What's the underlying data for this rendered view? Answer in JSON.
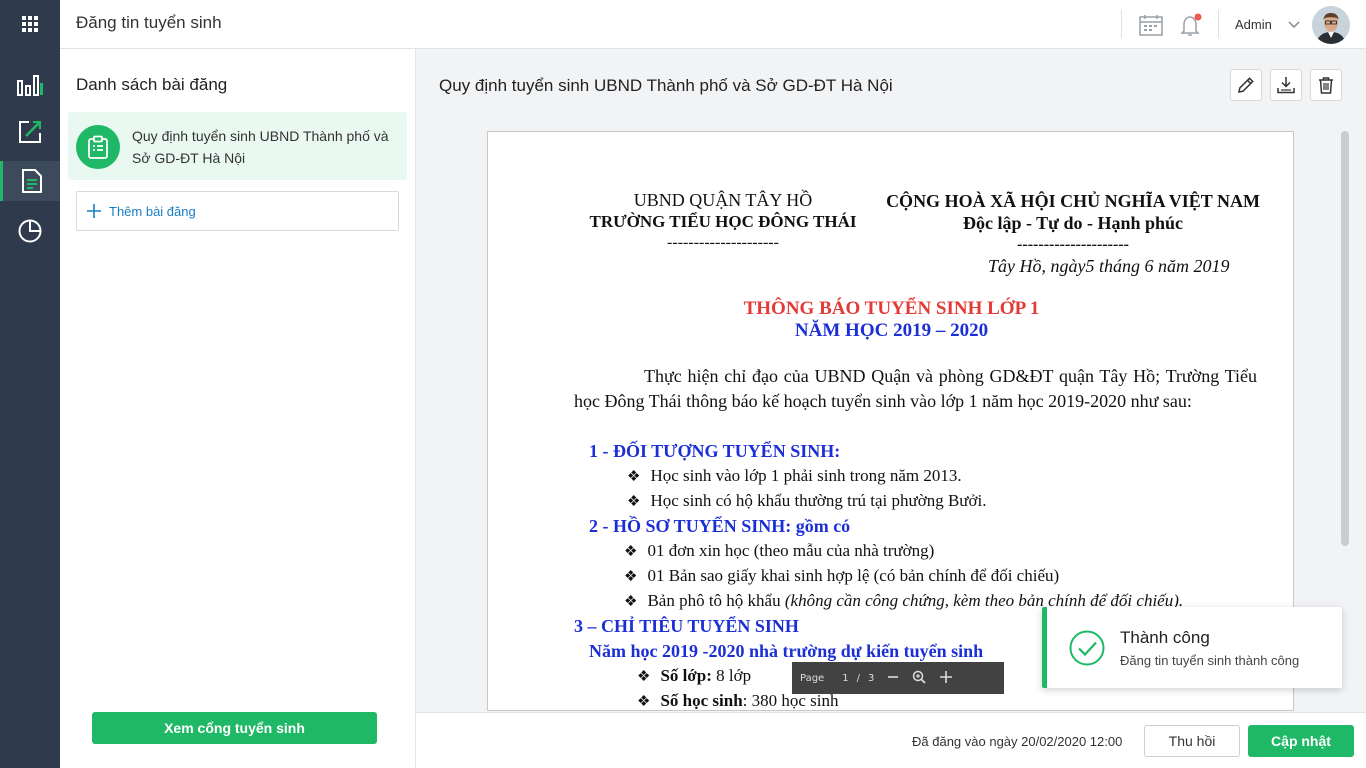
{
  "app": {
    "title": "Đăng tin tuyển sinh"
  },
  "topbar": {
    "user_name": "Admin",
    "icons": [
      "calendar-icon",
      "bell-icon",
      "chevron-down-icon"
    ],
    "notification_dot_color": "#f0574f"
  },
  "sidebar": {
    "items": [
      {
        "name": "dashboard",
        "icon": "bar-chart-icon"
      },
      {
        "name": "edit",
        "icon": "edit-icon"
      },
      {
        "name": "posts",
        "icon": "document-icon",
        "active": true
      },
      {
        "name": "reports",
        "icon": "pie-chart-icon"
      }
    ]
  },
  "list_panel": {
    "heading": "Danh sách bài đăng",
    "posts": [
      {
        "label": "Quy định tuyển sinh UBND Thành phố và Sở GD-ĐT Hà Nội"
      }
    ],
    "add_label": "Thêm bài đăng",
    "portal_button": "Xem cổng tuyển sinh"
  },
  "detail": {
    "title": "Quy định tuyển sinh UBND Thành phố và Sở GD-ĐT Hà Nội",
    "tools": [
      "edit-icon",
      "download-icon",
      "trash-icon"
    ],
    "posted_text": "Đã đăng vào ngày 20/02/2020 12:00",
    "withdraw_button": "Thu hồi",
    "update_button": "Cập nhật"
  },
  "document": {
    "left_header_1": "UBND QUẬN TÂY HỒ",
    "left_header_2": "TRƯỜNG TIỂU HỌC ĐÔNG THÁI",
    "left_dashes": "---------------------",
    "right_header_1": "CỘNG HOÀ XÃ HỘI CHỦ NGHĨA VIỆT NAM",
    "right_header_2": "Độc lập - Tự do - Hạnh phúc",
    "right_dashes": "---------------------",
    "date": "Tây Hồ, ngày5 tháng 6 năm 2019",
    "notice_title": "THÔNG BÁO TUYỂN SINH LỚP 1",
    "notice_year": "NĂM HỌC 2019 – 2020",
    "intro": "Thực hiện chỉ đạo của UBND Quận và phòng GD&ĐT quận Tây Hồ; Trường Tiểu học Đông Thái thông báo kế hoạch tuyển sinh vào lớp 1 năm học 2019-2020 như sau:",
    "section1": "1 - ĐỐI TƯỢNG TUYỂN SINH:",
    "s1_item1": "Học sinh vào lớp 1 phải sinh trong năm 2013.",
    "s1_item2": "Học sinh có hộ khẩu thường trú tại phường Bưởi.",
    "section2": "2 - HỒ SƠ TUYỂN SINH: gồm có",
    "s2_item1": "01 đơn xin học  (theo mẫu của nhà trường)",
    "s2_item2": "01 Bản sao giấy khai sinh hợp lệ (có bản chính để đối chiếu)",
    "s2_item3_a": "Bản phô tô hộ khẩu ",
    "s2_item3_b": "(không cần công chứng, kèm theo bản chính để đối chiếu).",
    "section3": "3 – CHỈ TIÊU TUYỂN SINH",
    "s3_sub": "Năm học 2019 -2020 nhà trường dự kiến tuyển sinh",
    "s3_item1_label": "Số lớp:",
    "s3_item1_value": " 8  lớp",
    "s3_item2_label": "Số học sinh",
    "s3_item2_value": ": 380  học sinh"
  },
  "pdf_toolbar": {
    "page_label": "Page",
    "current": "1",
    "sep": "/",
    "total": "3"
  },
  "toast": {
    "title": "Thành công",
    "message": "Đăng tin tuyển sinh thành công"
  },
  "colors": {
    "accent": "#1fb866",
    "rail": "#2f3b4c",
    "link": "#1a7fc2",
    "doc_red": "#e53935",
    "doc_blue": "#1c2fd6"
  }
}
